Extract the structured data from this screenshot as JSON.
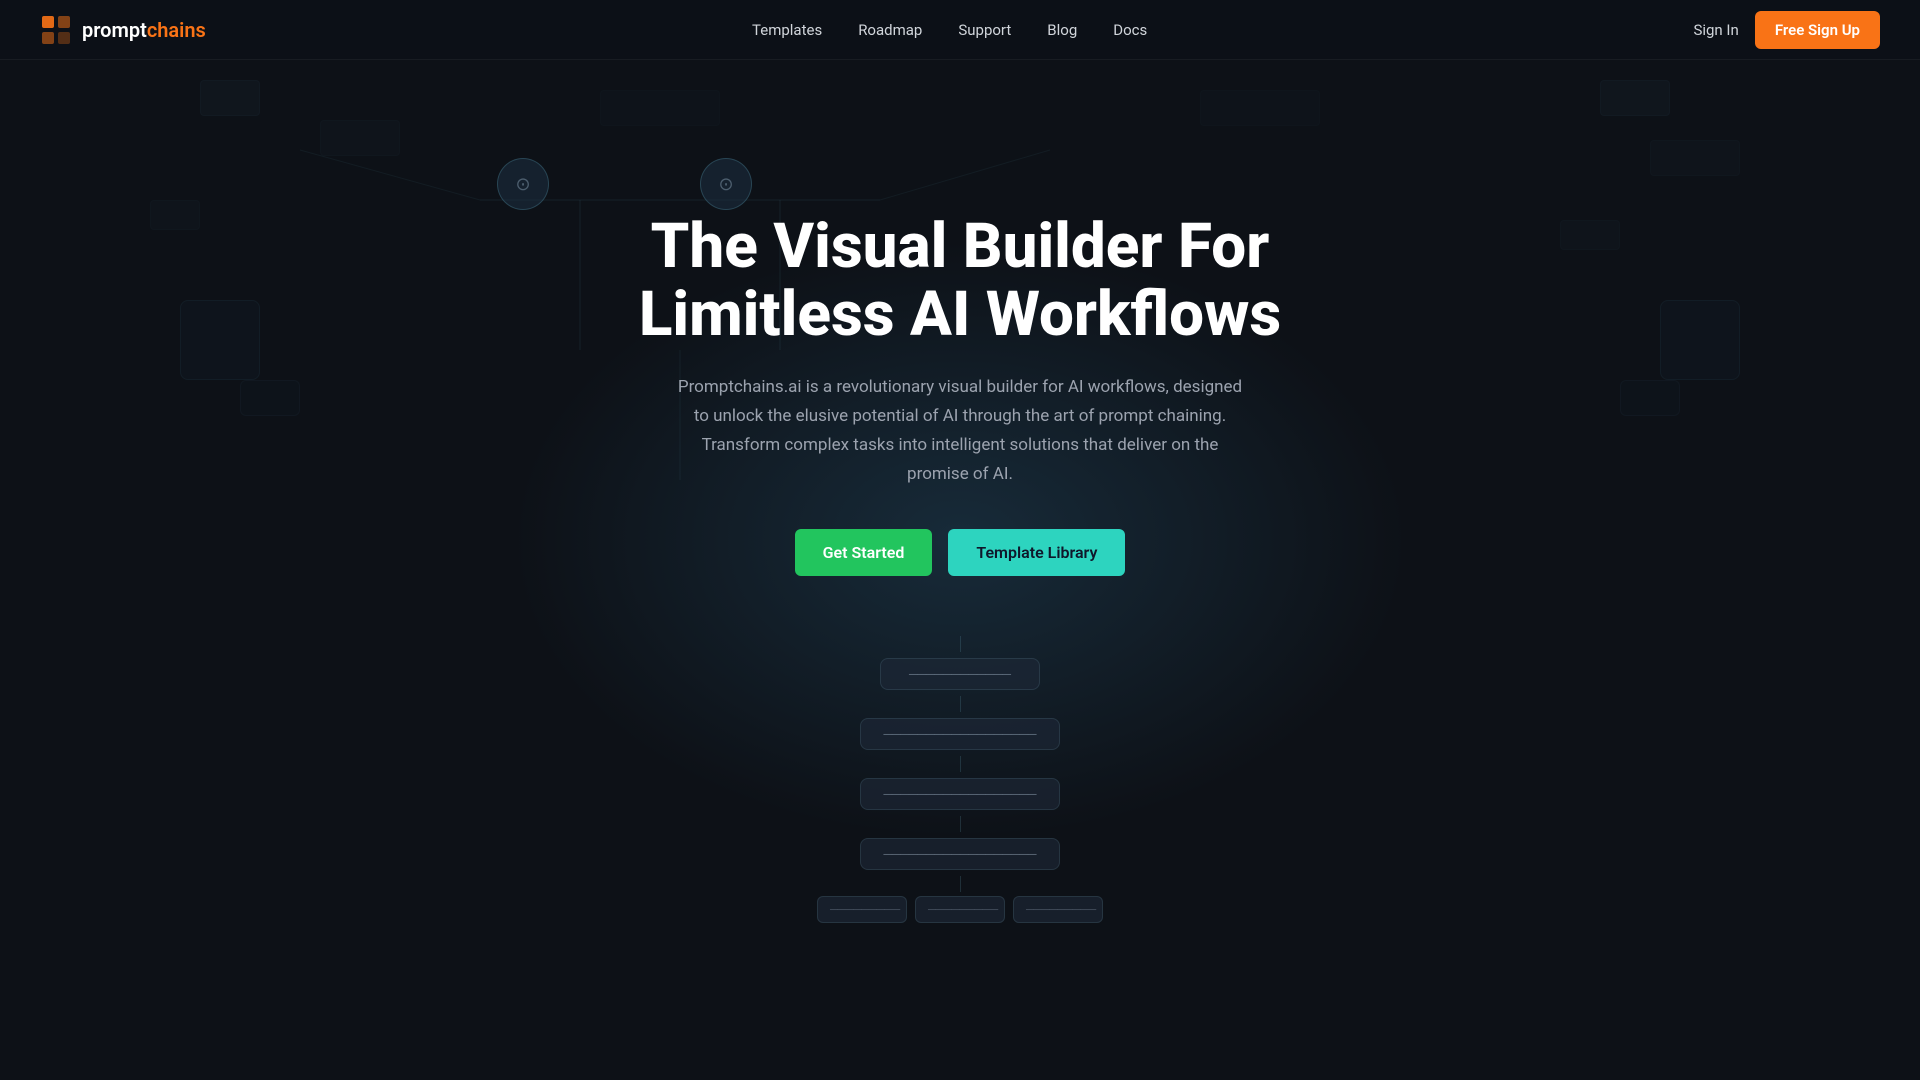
{
  "brand": {
    "logo_prompt": "prompt",
    "logo_chains": "chains",
    "logo_full": "promptchains",
    "icon_symbol": "⬡"
  },
  "navbar": {
    "links": [
      {
        "label": "Templates",
        "id": "nav-templates"
      },
      {
        "label": "Roadmap",
        "id": "nav-roadmap"
      },
      {
        "label": "Support",
        "id": "nav-support"
      },
      {
        "label": "Blog",
        "id": "nav-blog"
      },
      {
        "label": "Docs",
        "id": "nav-docs"
      }
    ],
    "sign_in_label": "Sign In",
    "free_signup_label": "Free Sign Up"
  },
  "hero": {
    "title_line1": "The Visual Builder For",
    "title_line2": "Limitless AI Workflows",
    "subtitle": "Promptchains.ai is a revolutionary visual builder for AI workflows, designed to unlock the elusive potential of AI through the art of prompt chaining. Transform complex tasks into intelligent solutions that deliver on the promise of AI.",
    "btn_get_started": "Get Started",
    "btn_template_library": "Template Library"
  },
  "colors": {
    "accent_orange": "#f97316",
    "accent_green": "#22c55e",
    "accent_teal": "#2dd4bf",
    "bg": "#0d1117"
  }
}
